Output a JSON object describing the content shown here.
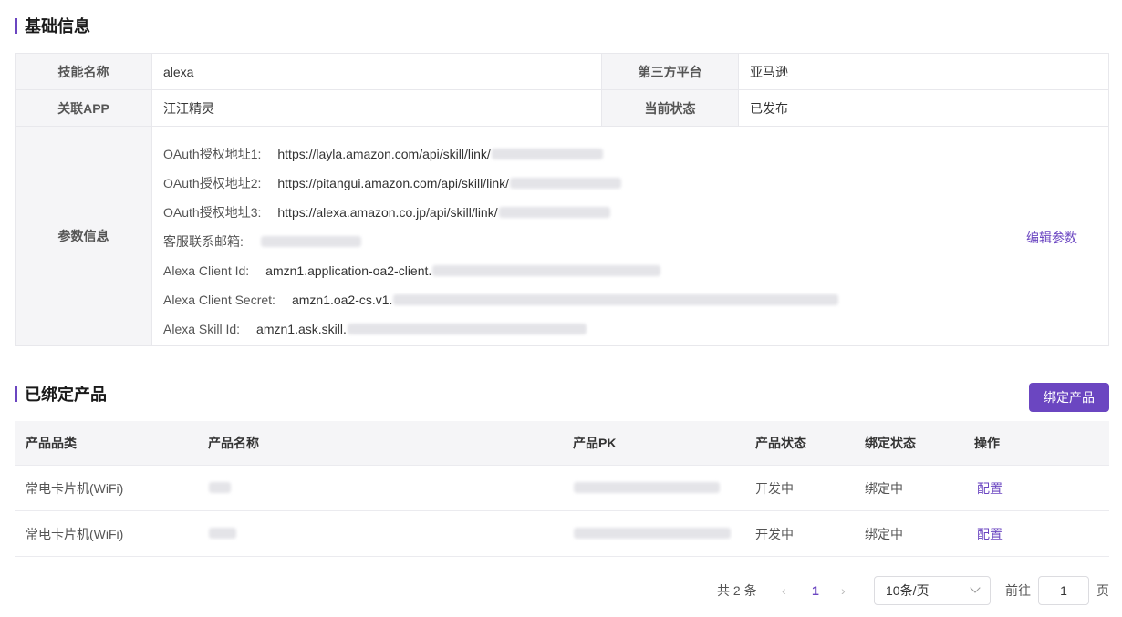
{
  "basic": {
    "title": "基础信息",
    "skill_name_label": "技能名称",
    "skill_name": "alexa",
    "platform_label": "第三方平台",
    "platform": "亚马逊",
    "app_label": "关联APP",
    "app": "汪汪精灵",
    "status_label": "当前状态",
    "status": "已发布",
    "params_label": "参数信息",
    "edit_params": "编辑参数",
    "params": [
      {
        "key": "OAuth授权地址1:",
        "value": "https://layla.amazon.com/api/skill/link/"
      },
      {
        "key": "OAuth授权地址2:",
        "value": "https://pitangui.amazon.com/api/skill/link/"
      },
      {
        "key": "OAuth授权地址3:",
        "value": "https://alexa.amazon.co.jp/api/skill/link/"
      },
      {
        "key": "客服联系邮箱:",
        "value": ""
      },
      {
        "key": "Alexa Client Id:",
        "value": "amzn1.application-oa2-client."
      },
      {
        "key": "Alexa Client Secret:",
        "value": "amzn1.oa2-cs.v1."
      },
      {
        "key": "Alexa Skill Id:",
        "value": "amzn1.ask.skill."
      }
    ]
  },
  "products": {
    "title": "已绑定产品",
    "bind_button": "绑定产品",
    "columns": [
      "产品品类",
      "产品名称",
      "产品PK",
      "产品状态",
      "绑定状态",
      "操作"
    ],
    "rows": [
      {
        "category": "常电卡片机(WiFi)",
        "product_status": "开发中",
        "bind_status": "绑定中",
        "action": "配置"
      },
      {
        "category": "常电卡片机(WiFi)",
        "product_status": "开发中",
        "bind_status": "绑定中",
        "action": "配置"
      }
    ]
  },
  "pagination": {
    "total": "共 2 条",
    "current_page": "1",
    "page_size": "10条/页",
    "goto_label": "前往",
    "goto_value": "1",
    "page_suffix": "页"
  },
  "colors": {
    "accent": "#6b46c1",
    "header_bg": "#f5f5f7",
    "border": "#e8e8ec"
  }
}
